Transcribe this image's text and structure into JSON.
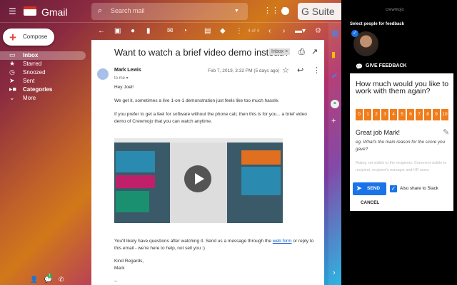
{
  "app": {
    "name": "Gmail",
    "account_badge": "G Suite"
  },
  "search": {
    "placeholder": "Search mail"
  },
  "compose_label": "Compose",
  "nav": [
    {
      "label": "Inbox",
      "icon": "inbox-icon"
    },
    {
      "label": "Starred",
      "icon": "star-icon"
    },
    {
      "label": "Snoozed",
      "icon": "clock-icon"
    },
    {
      "label": "Sent",
      "icon": "send-icon"
    },
    {
      "label": "Categories",
      "icon": "label-icon"
    },
    {
      "label": "More",
      "icon": "chevron-down-icon"
    }
  ],
  "toolbar": {
    "pagination": "4 of 4"
  },
  "email": {
    "subject": "Want to watch a brief video demo instead?",
    "label": "Inbox ×",
    "sender": "Mark Lewis",
    "to": "to me ▾",
    "date": "Feb 7, 2019, 3:32 PM (5 days ago)",
    "greeting": "Hey Joel!",
    "p1": "We get it, sometimes a live 1-on-1 demonstration just feels like too much hassle.",
    "p2": "If you prefer to get a feel for software without the phone call, then this is for you... a brief video demo of Crewmojo that you can watch anytime.",
    "p3_before": "You'll likely have questions after watching it. Send us a message through the ",
    "p3_link": "web form",
    "p3_after": " or reply to this email - we're here to help, not sell you :)",
    "signoff": "Kind Regards,",
    "signname": "Mark",
    "sigdash": "--"
  },
  "crewmojo": {
    "brand": "crewmojo",
    "select_label": "Select people for feedback",
    "give_feedback": "GIVE FEEDBACK",
    "question": "How much would you like to work with them again?",
    "scale": [
      "0",
      "1",
      "2",
      "3",
      "4",
      "5",
      "6",
      "7",
      "8",
      "9",
      "10"
    ],
    "comment_title": "Great job Mark!",
    "comment_placeholder": "eg. What's the main reason for the score you gave?",
    "note": "Rating not visible to the recipients. Comment visible to recipient, recipient's manager and HR users",
    "send": "SEND",
    "share_slack": "Also share to Slack",
    "share_checked": true,
    "cancel": "CANCEL",
    "accent": "#f07c1a"
  },
  "chat_badge": "1"
}
